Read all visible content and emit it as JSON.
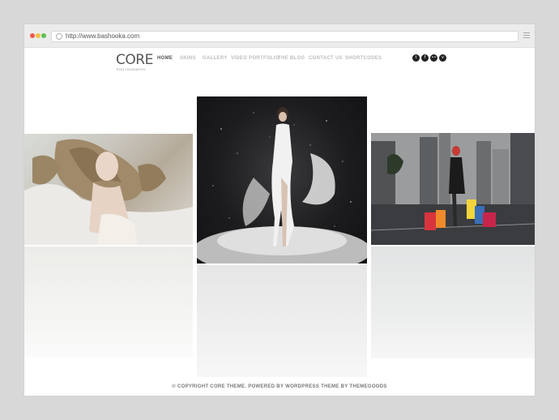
{
  "browser": {
    "url": "http://www.bashooka.com"
  },
  "site": {
    "logo_main": "CORE",
    "logo_sub": "PHOTOGRAPHY"
  },
  "nav": {
    "items": [
      {
        "label": "HOME"
      },
      {
        "label": "SKINS"
      },
      {
        "label": "GALLERY"
      },
      {
        "label": "VIDEO PORTFOLIO"
      },
      {
        "label": "THE BLOG"
      },
      {
        "label": "CONTACT US"
      },
      {
        "label": "SHORTCODES"
      }
    ],
    "active": "HOME"
  },
  "social": {
    "icons": [
      "twitter-icon",
      "facebook-icon",
      "flickr-icon",
      "vimeo-icon"
    ],
    "glyphs": [
      "t",
      "f",
      "••",
      "v"
    ]
  },
  "gallery": {
    "photos": [
      {
        "icon": "woman-portrait-photo"
      },
      {
        "icon": "woman-white-dress-photo"
      },
      {
        "icon": "woman-shopping-bags-photo"
      }
    ]
  },
  "footer": {
    "text": "© COPYRIGHT CORE THEME. POWERED BY WORDPRESS THEME BY THEMEGOODS"
  },
  "colors": {
    "accent_text": "#555555",
    "muted_nav": "#bdbdbd",
    "social_bg": "#222222"
  }
}
